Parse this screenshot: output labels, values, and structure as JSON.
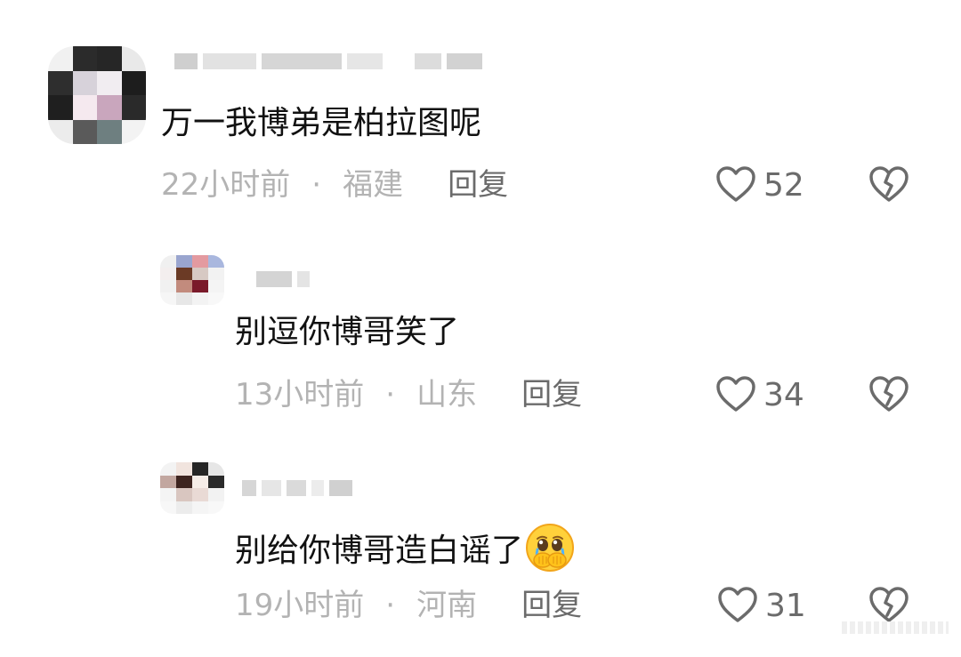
{
  "comments": [
    {
      "text": "万一我博弟是柏拉图呢",
      "time": "22小时前",
      "location": "福建",
      "reply_label": "回复",
      "likes": "52"
    },
    {
      "text": "别逗你博哥笑了",
      "time": "13小时前",
      "location": "山东",
      "reply_label": "回复",
      "likes": "34"
    },
    {
      "text": "别给你博哥造白谣了",
      "time": "19小时前",
      "location": "河南",
      "reply_label": "回复",
      "likes": "31",
      "emoji": "crying-hands-over-mouth-emoji"
    }
  ],
  "separator": "·",
  "icons": {
    "like": "heart-outline-icon",
    "dislike": "broken-heart-icon"
  },
  "colors": {
    "text": "#111111",
    "meta": "#b3b3b3",
    "reply": "#6b6b6b",
    "icon": "#6b6b6b",
    "emoji": "#ffd13b"
  }
}
